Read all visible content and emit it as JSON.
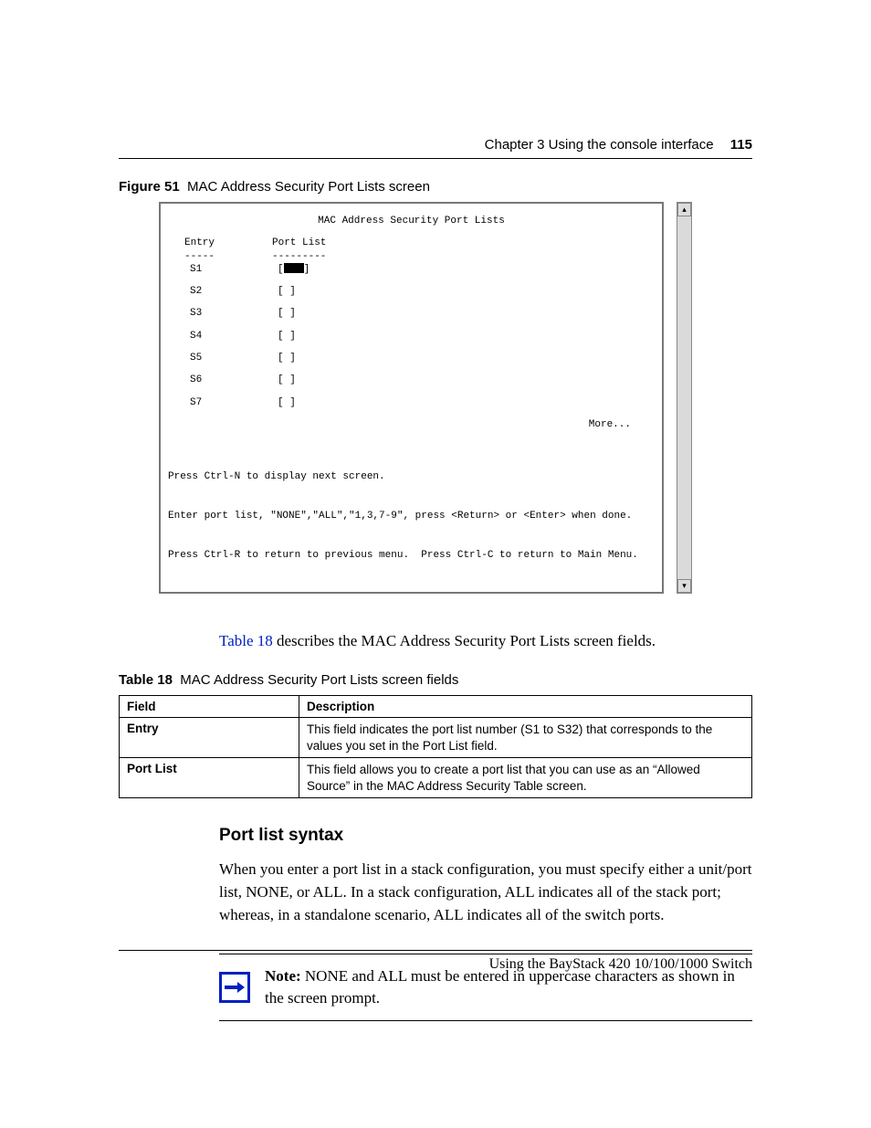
{
  "header": {
    "chapter": "Chapter 3  Using the console interface",
    "page_number": "115"
  },
  "figure": {
    "label": "Figure 51",
    "title": "MAC Address Security Port Lists screen"
  },
  "console": {
    "title": "MAC Address Security Port Lists",
    "col_entry": "Entry",
    "col_portlist": "Port List",
    "dash1": "-----",
    "dash2": "---------",
    "rows": [
      {
        "entry": "S1",
        "port": "[   ]"
      },
      {
        "entry": "S2",
        "port": "[  ]"
      },
      {
        "entry": "S3",
        "port": "[  ]"
      },
      {
        "entry": "S4",
        "port": "[  ]"
      },
      {
        "entry": "S5",
        "port": "[  ]"
      },
      {
        "entry": "S6",
        "port": "[  ]"
      },
      {
        "entry": "S7",
        "port": "[  ]"
      }
    ],
    "more": "More...",
    "help1": "Press Ctrl-N to display next screen.",
    "help2": "Enter port list, \"NONE\",\"ALL\",\"1,3,7-9\", press <Return> or <Enter> when done.",
    "help3": "Press Ctrl-R to return to previous menu.  Press Ctrl-C to return to Main Menu."
  },
  "intro_paragraph": {
    "xref": "Table 18",
    "rest": " describes the MAC Address Security Port Lists screen fields."
  },
  "table": {
    "label": "Table 18",
    "title": "MAC Address Security Port Lists screen fields",
    "head_field": "Field",
    "head_desc": "Description",
    "rows": [
      {
        "field": "Entry",
        "desc": "This field indicates the port list number (S1 to S32) that corresponds to the values you set in the Port List field."
      },
      {
        "field": "Port List",
        "desc": "This field allows you to create a port list that you can use as an “Allowed Source” in the MAC Address Security Table screen."
      }
    ]
  },
  "section_heading": "Port list syntax",
  "section_body": "When you enter a port list in a stack configuration, you must specify either a unit/port list, NONE, or ALL. In a stack configuration, ALL indicates all of the stack port; whereas, in a standalone scenario, ALL indicates all of the switch ports.",
  "note": {
    "label": "Note:",
    "text": " NONE and ALL must be entered in uppercase characters as shown in the screen prompt."
  },
  "footer": "Using the BayStack 420 10/100/1000 Switch"
}
